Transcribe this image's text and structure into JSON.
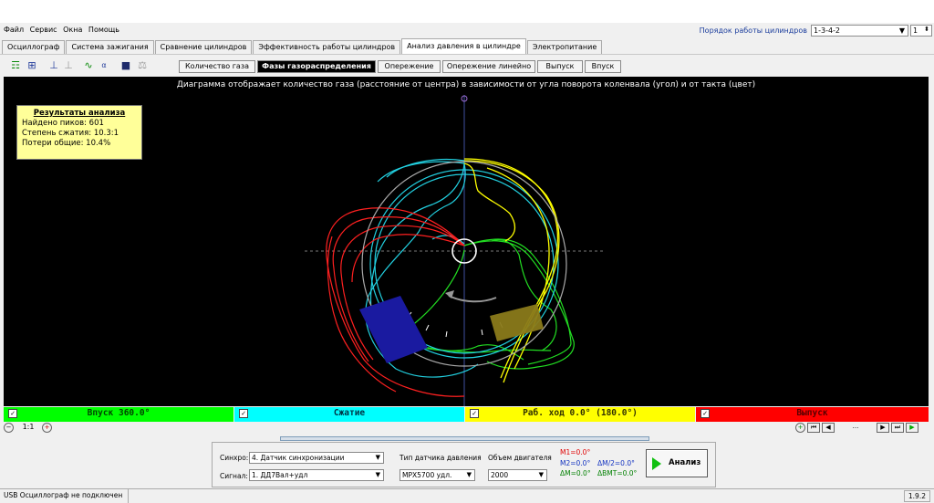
{
  "menu": [
    "Файл",
    "Сервис",
    "Окна",
    "Помощь"
  ],
  "order": {
    "label": "Порядок работы цилиндров",
    "value": "1-3-4-2",
    "cyl": "1"
  },
  "tabs": [
    "Осциллограф",
    "Система зажигания",
    "Сравнение цилиндров",
    "Эффективность работы цилиндров",
    "Анализ давления в цилиндре",
    "Электропитание"
  ],
  "toolbar_icons": [
    "sync-icon",
    "hz-icon",
    "auto-icon",
    "zero-icon",
    "curve-icon",
    "alpha-icon",
    "save-icon",
    "compare-icon"
  ],
  "subtabs": [
    "Количество газа",
    "Фазы газораспределения",
    "Опережение",
    "Опережение линейно",
    "Выпуск",
    "Впуск"
  ],
  "plot": {
    "title": "Диаграмма отображает количество газа (расстояние от центра) в зависимости от угла поворота коленвала (угол) и от такта (цвет)",
    "top_marker": "0"
  },
  "results": {
    "header": "Результаты анализа",
    "peaks": "Найдено пиков: 601",
    "compression": "Степень сжатия: 10.3:1",
    "losses": "Потери общие: 10.4%"
  },
  "legend": [
    {
      "label": "Впуск 360.0°",
      "color": "#00ff00"
    },
    {
      "label": "Сжатие",
      "color": "#00ffff"
    },
    {
      "label": "Раб. ход 0.0° (180.0°)",
      "color": "#ffff00"
    },
    {
      "label": "Выпуск",
      "color": "#ff0000"
    }
  ],
  "zoom": {
    "ratio": "1:1"
  },
  "nav": {
    "dots": "..."
  },
  "controls": {
    "sync_label": "Синхро:",
    "sync_value": "4. Датчик синхронизации",
    "signal_label": "Сигнал:",
    "signal_value": "1. ДД7Вал+удл",
    "sensor_label": "Тип датчика давления",
    "sensor_value": "MPX5700 удл.",
    "volume_label": "Объем двигателя",
    "volume_value": "2000",
    "m1": "М1=0.0°",
    "m2": "М2=0.0°",
    "dm": "ΔМ=0.0°",
    "dm2": "ΔМ/2=0.0°",
    "dbmt": "ΔВМТ=0.0°",
    "analyze": "Анализ"
  },
  "status": {
    "text": "USB Осциллограф не подключен",
    "version": "1.9.2"
  }
}
